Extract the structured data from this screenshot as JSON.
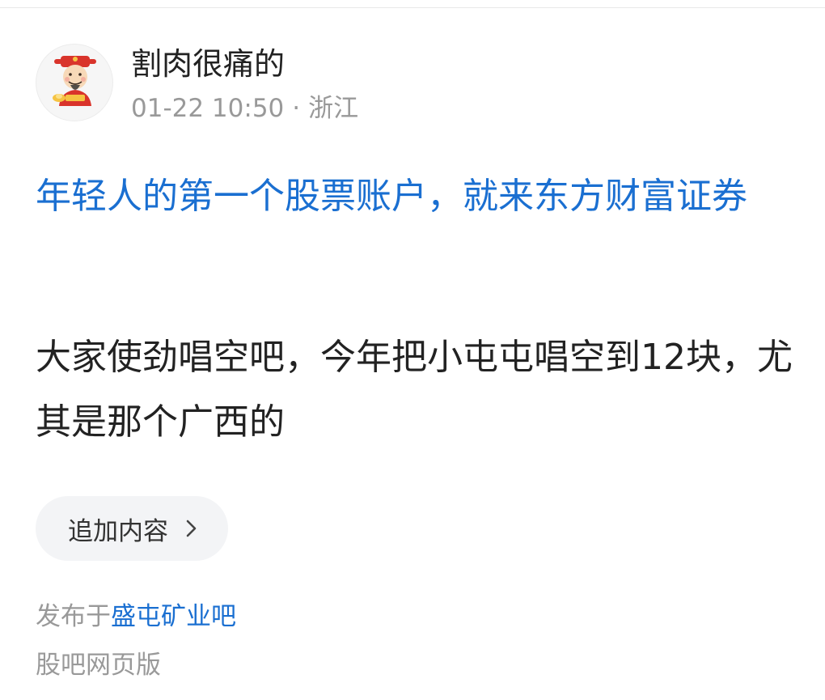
{
  "post": {
    "author_name": "割肉很痛的",
    "avatar_icon": "god-of-wealth-avatar-icon",
    "timestamp": "01-22 10:50",
    "separator": "·",
    "location": "浙江",
    "title": "年轻人的第一个股票账户，就来东方财富证券",
    "body": "大家使劲唱空吧，今年把小屯屯唱空到12块，尤其是那个广西的"
  },
  "actions": {
    "append_label": "追加内容",
    "append_icon": "chevron-right-icon"
  },
  "footer": {
    "posted_prefix": "发布于",
    "bar_name": "盛屯矿业吧",
    "web_version_label": "股吧网页版"
  },
  "colors": {
    "link_blue": "#1a6fd1",
    "muted_gray": "#999999",
    "text_dark": "#222222",
    "button_bg": "#f3f4f6"
  }
}
